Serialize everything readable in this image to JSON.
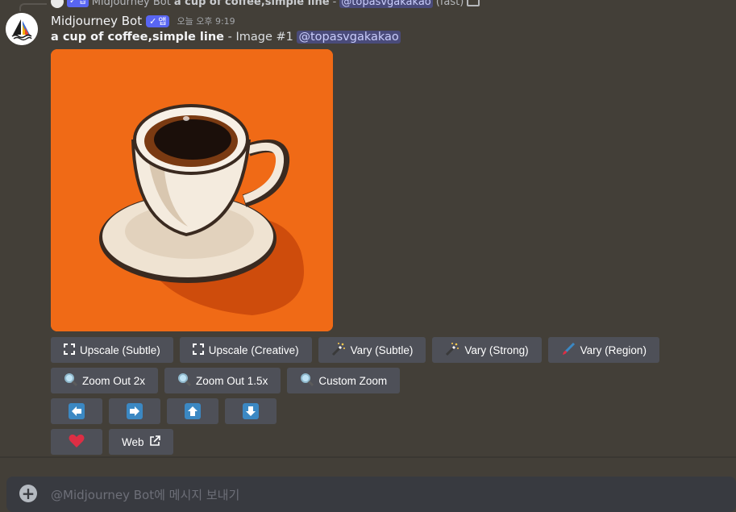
{
  "reply": {
    "username": "Midjourney Bot",
    "badge": "✓ 앱",
    "prompt": "a cup of coffee,simple line",
    "dash": "-",
    "mention": "@topasvgakakao",
    "speed": "(fast)"
  },
  "message": {
    "username": "Midjourney Bot",
    "badge_check": "✓",
    "badge_label": "앱",
    "timestamp": "오늘 오후 9:19",
    "prompt": "a cup of coffee,simple line",
    "separator": "-",
    "image_label": "Image #1",
    "mention": "@topasvgakakao"
  },
  "buttons": {
    "row1": [
      {
        "label": "Upscale (Subtle)",
        "icon": "expand-icon"
      },
      {
        "label": "Upscale (Creative)",
        "icon": "expand-icon"
      },
      {
        "label": "Vary (Subtle)",
        "icon": "magic-wand-icon"
      },
      {
        "label": "Vary (Strong)",
        "icon": "magic-wand-icon"
      },
      {
        "label": "Vary (Region)",
        "icon": "paintbrush-icon"
      }
    ],
    "row2": [
      {
        "label": "Zoom Out 2x",
        "icon": "magnifier-icon"
      },
      {
        "label": "Zoom Out 1.5x",
        "icon": "magnifier-icon"
      },
      {
        "label": "Custom Zoom",
        "icon": "magnifier-icon"
      }
    ],
    "row3": [
      {
        "icon": "arrow-left-icon",
        "glyph": "🡄"
      },
      {
        "icon": "arrow-right-icon",
        "glyph": "🡆"
      },
      {
        "icon": "arrow-up-icon",
        "glyph": "🡅"
      },
      {
        "icon": "arrow-down-icon",
        "glyph": "🡇"
      }
    ],
    "row4": {
      "heart_icon": "heart-icon",
      "web_label": "Web",
      "web_icon": "external-link-icon"
    }
  },
  "input": {
    "placeholder": "@Midjourney Bot에 메시지 보내기"
  },
  "colors": {
    "background": "#433f38",
    "button": "#4e5058",
    "blurple": "#5865f2",
    "image_bg": "#f06a16",
    "arrow_blue": "#3b88c3",
    "heart": "#dd2e44"
  }
}
